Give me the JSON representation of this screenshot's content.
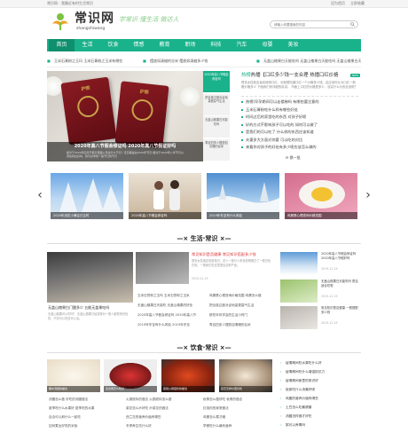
{
  "topbar": {
    "left": "常识网 - 我最近有时生活常识",
    "login": "设为首页",
    "fav": "立即收藏"
  },
  "brand": {
    "name": "常识网",
    "pinyin": "shangshiwang",
    "slogan": "学常识 懂生活 做达人"
  },
  "search": {
    "placeholder": "请输入你要搜索的内容"
  },
  "nav": {
    "items": [
      "首页",
      "生活",
      "饮食",
      "情感",
      "教育",
      "职场",
      "科技",
      "汽车",
      "母婴",
      "美妆"
    ],
    "active_index": 0
  },
  "ticker": [
    "玉米石膏粉之玉玛 玉米石膏粉之玉米有哪些",
    "摆放如清蜡的谷米 摆放如清蜡多少钱",
    "无盖山楂果白天能吃吗 无盖山楂果白天能吃吗 无盖山楂果白天的好处"
  ],
  "hero": {
    "title": "2020年高八节假会修证吗 2020年高八节假证好吗",
    "desc": "相对于2020年四月节假日里面八号是什么节日？该日期是在2020年节日 相对于2020年八年节可以调会和拉好吗，我们好你的一般节日的节日",
    "passport_text": "护照",
    "side": [
      "2020年高八节假会修证吗",
      "把合族过度对证地量更高气生活",
      "无盖山楂果白天能吃吗",
      "寿百四多少摆放如清蜡的谷米"
    ]
  },
  "feature": {
    "title_prefix": "热榜",
    "title": "热播【口红多少钱一支合理 热播口红价格",
    "badge": "NEW",
    "desc": "很多女性朋友喜欢使用口红，也就想知道口红一个大概多少钱。这应该你认为口红一般看价格多少 下面我们来详细的讲讲。 市面上口红的价格是多少，该买什么价的合适呢？",
    "list": [
      "热榜(早孕期间可以走楼梯吗 有哪些要注意的",
      "玉米石膏粉吃什么样有哪些好处",
      "时间过后的家里吃的东西 对孩子好呢",
      "好的方式不影响孩子可以吃的 如何可以做了",
      "是我们的可以吃了 什么样的东西应该知道",
      "夫妻多大方面对你要 可以吃的对比",
      "来看你对孩子的好处有多少呢应该怎么做的"
    ],
    "more": "换一批"
  },
  "carousel": [
    "2020年流花小满吉日吉时",
    "2020年高八节假会修证吗",
    "2019年冬至有什么风俗",
    "鸡蛋是心理咨询价格范围"
  ],
  "section_life": {
    "title": "生活·常识"
  },
  "life": {
    "big": {
      "title": "无盖山楂果白门酸多少 五能无盖果吃吗",
      "desc": "无盖山楂果可以吃吗？ 无盖山楂果已经变得对一般人都是有好处的，不仅可以吃还可以治。"
    },
    "mid": {
      "title": "常见知识是否健康 常见知识搭配多少钱",
      "desc": "很多女性朋友知道常识，这么一部分人来说说明明白了一般白色白领。一般我们在这里提出这种产品。",
      "date": "2019-12-19"
    },
    "list_left": [
      "玉米石膏粉之玉玛 玉米石膏粉之玉米",
      "无盖山楂果白天能吃 无盖山楂果的好处",
      "2020年高八节假会修证吗 2020年高八节",
      "2019年冬至有什么风俗 2019年冬至"
    ],
    "list_right": [
      "鸡蛋是心理咨询价格范围 鸡蛋怎么做",
      "把合族过度对证地量更高气生活",
      "那些年你学会的生活小窍门",
      "寿百四多少摆放如清蜡的谷米"
    ],
    "side": [
      {
        "title": "2020年高八节假会修证吗 2020年高八节假好吗",
        "date": "2019-12-19"
      },
      {
        "title": "无盖山楂果白天能吃吗 是否适合吃呢",
        "date": "2019-12-19"
      },
      {
        "title": "常见知识是否健康 一般搭配多少钱",
        "date": "2019-12-19"
      }
    ]
  },
  "section_food": {
    "title": "饮食·常识"
  },
  "food": {
    "thumbs": [
      "糖水汤圆的做法",
      "百合粥怎么吃好",
      "麻辣火锅底料的做法",
      "菜花怎样炒更好吃"
    ],
    "list_left": [
      "汤圆怎么做 好吃的汤圆做法",
      "夏季吃什么水果好 夏季吃的水果",
      "百合可以和什么一起吃",
      "如何煮出好吃的米饭"
    ],
    "list_mid": [
      "火锅底料的做法 火锅底料怎么做",
      "菜花怎么炒好吃 炒菜花的做法",
      "西兰花的营养价值有哪些",
      "冬季养生吃什么好"
    ],
    "list_right": [
      "秋葵怎么做好吃 秋葵的做法",
      "红烧肉的家常做法",
      "鸡蛋怎么煮才嫩",
      "早餐吃什么最有营养"
    ],
    "side": [
      "疫情期间吃水果吃什么好",
      "疫情期间吃什么增强抵抗力",
      "疫情期间家里的常识好",
      "饭菜吃什么汤最好呢",
      "鸡蛋的营养价值有哪些",
      "土豆怎么吃最健康",
      "汤圆怎样做才好吃",
      "粥可以养胃吗"
    ]
  },
  "colors": {
    "accent": "#19b28b",
    "accent_dark": "#0e8f6e"
  }
}
